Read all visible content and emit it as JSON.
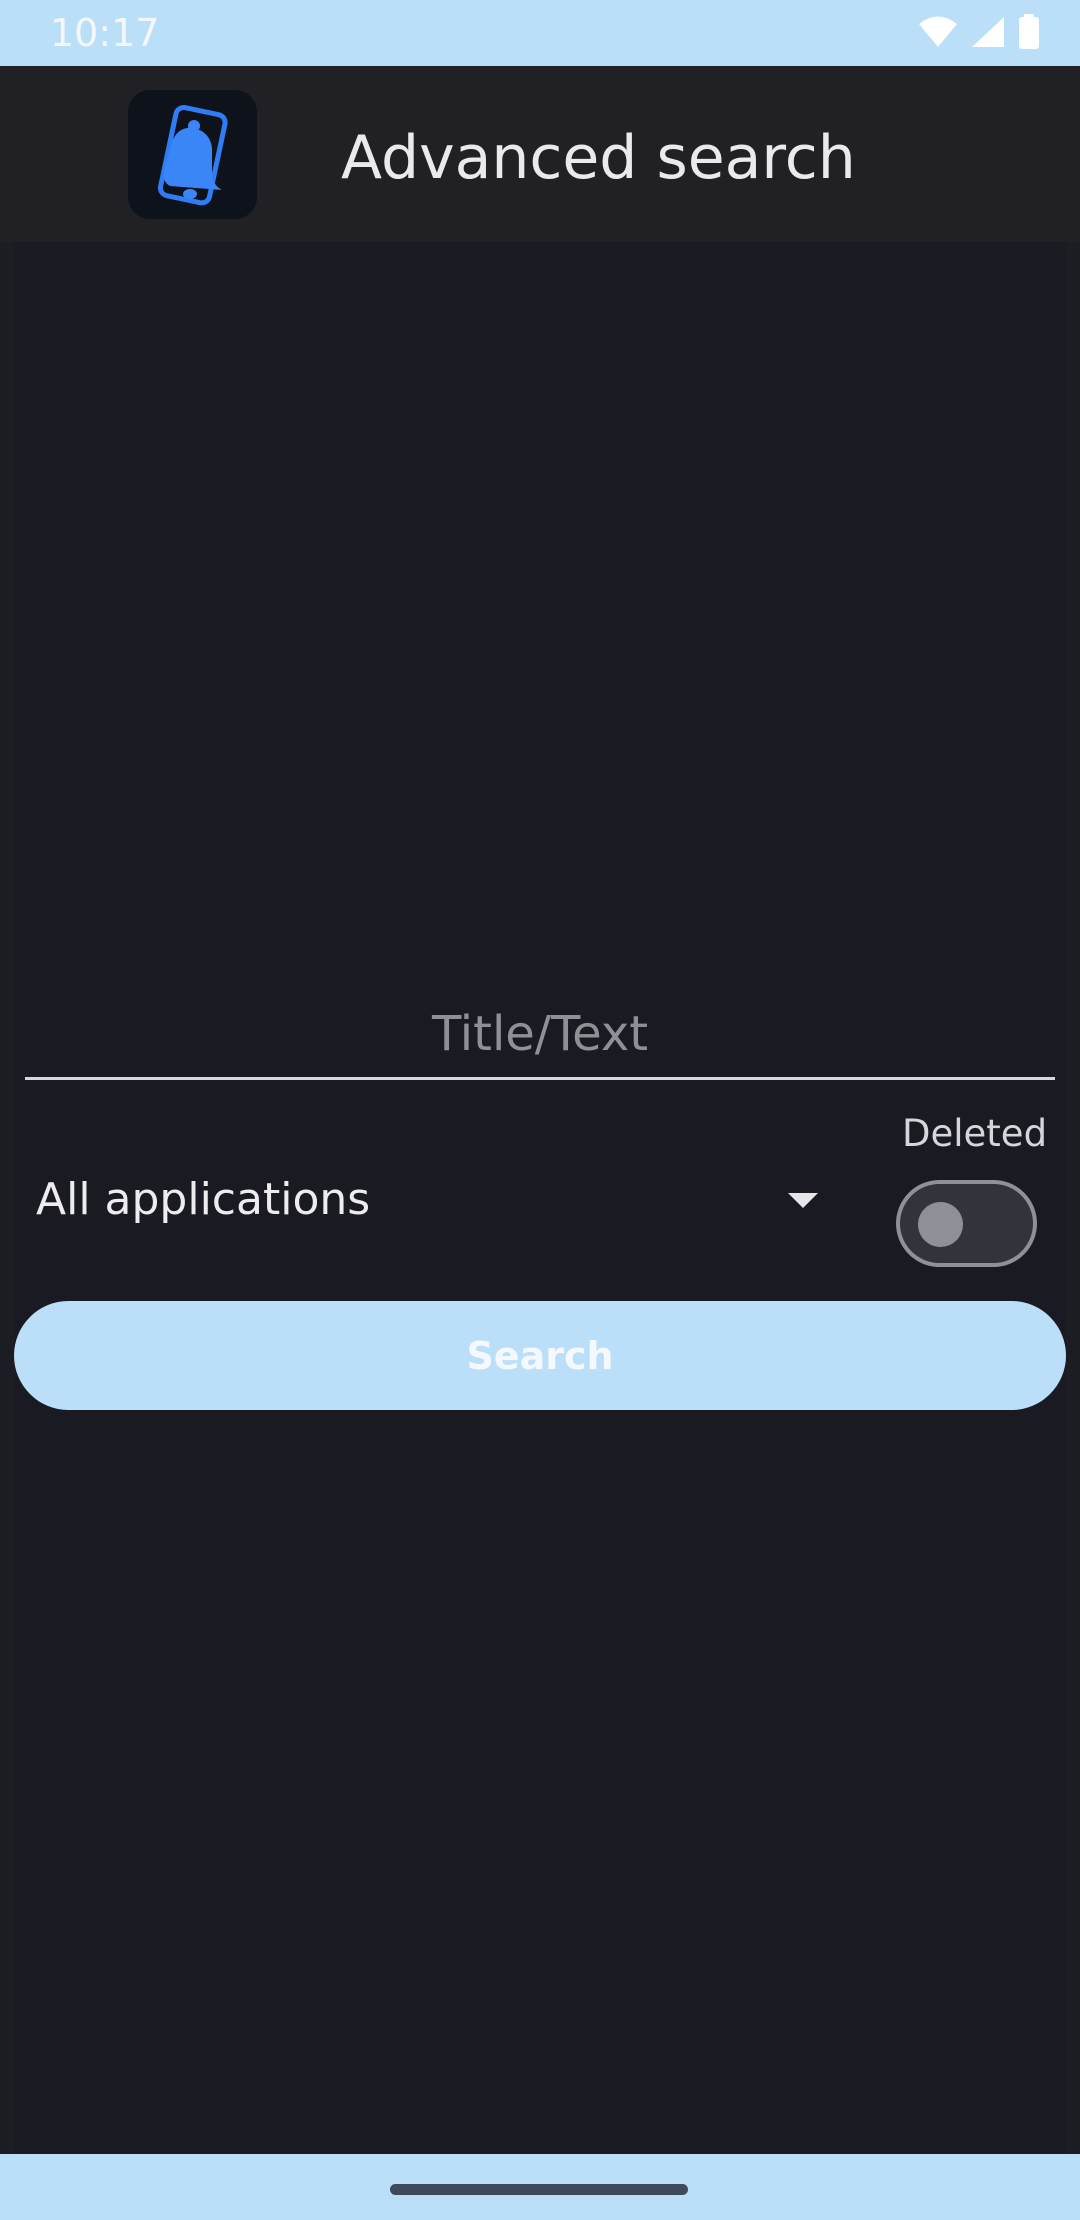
{
  "status_bar": {
    "time": "10:17",
    "icons": [
      "wifi-icon",
      "cell-signal-icon",
      "battery-icon"
    ]
  },
  "app_bar": {
    "title": "Advanced search",
    "icon": "bell-phone-icon"
  },
  "form": {
    "title_text_placeholder": "Title/Text",
    "title_text_value": "",
    "application_select_value": "All applications",
    "deleted_label": "Deleted",
    "deleted_enabled": false,
    "search_label": "Search"
  },
  "colors": {
    "accent": "#bbdef9",
    "background": "#1a1b22",
    "app_bar": "#212024",
    "icon_blue": "#2f7cf5"
  }
}
